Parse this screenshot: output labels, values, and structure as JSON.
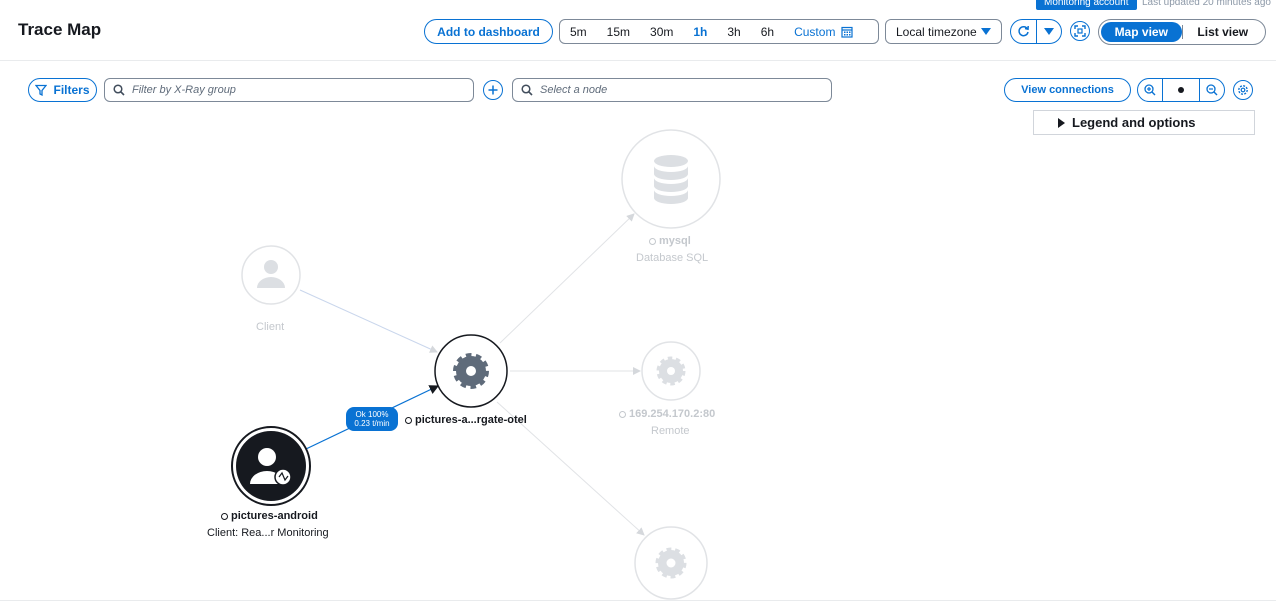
{
  "header": {
    "monitoring_account": "Monitoring account",
    "last_updated": "Last updated 20 minutes ago",
    "title": "Trace Map",
    "add_to_dashboard": "Add to dashboard",
    "time_ranges": [
      "5m",
      "15m",
      "30m",
      "1h",
      "3h",
      "6h"
    ],
    "active_range": "1h",
    "custom_label": "Custom",
    "timezone": "Local timezone",
    "views": [
      "Map view",
      "List view"
    ],
    "active_view": "Map view"
  },
  "toolbar": {
    "filters_label": "Filters",
    "group_placeholder": "Filter by X-Ray group",
    "node_placeholder": "Select a node",
    "view_connections": "View connections",
    "legend_label": "Legend and options"
  },
  "nodes": [
    {
      "name": "mysql",
      "type": "Database SQL",
      "icon": "database-icon",
      "state": "faded"
    },
    {
      "name": "",
      "type": "Client",
      "icon": "user-icon",
      "state": "faded"
    },
    {
      "name": "pictures-a...rgate-otel",
      "type": "",
      "icon": "gear-icon",
      "state": "active"
    },
    {
      "name": "169.254.170.2:80",
      "type": "Remote",
      "icon": "gear-icon",
      "state": "faded"
    },
    {
      "name": "pictures-android",
      "type": "Client: Rea...r Monitoring",
      "icon": "user-monitoring-icon",
      "state": "selected"
    },
    {
      "name": "",
      "type": "",
      "icon": "gear-icon",
      "state": "faded"
    }
  ],
  "edge": {
    "status": "Ok 100%",
    "rate": "0.23 t/min"
  },
  "colors": {
    "accent": "#0972d3",
    "node_dark": "#16191f",
    "faded": "#c4c8cd"
  }
}
